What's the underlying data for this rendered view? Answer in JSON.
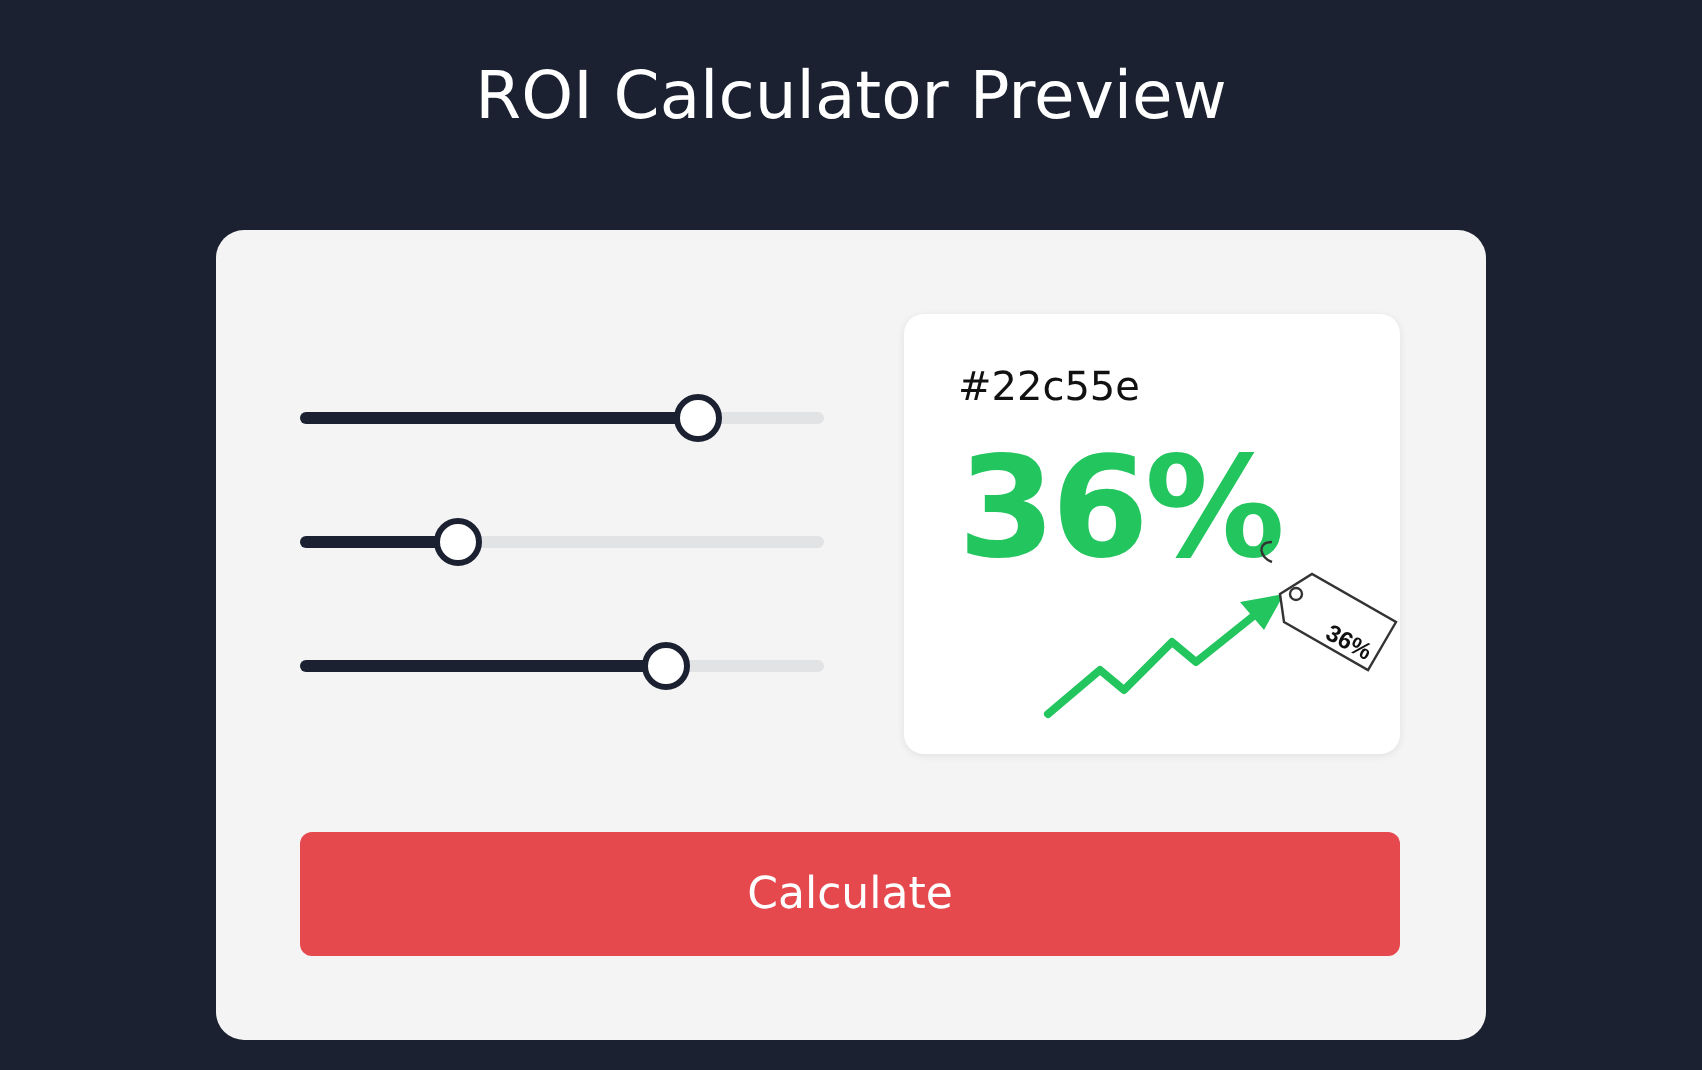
{
  "title": "ROI Calculator Preview",
  "sliders": [
    {
      "level": 0.76
    },
    {
      "level": 0.3
    },
    {
      "level": 0.7
    }
  ],
  "result": {
    "caption": "#22c55e",
    "value": "36%",
    "tag": "36%"
  },
  "button": "Calculate"
}
